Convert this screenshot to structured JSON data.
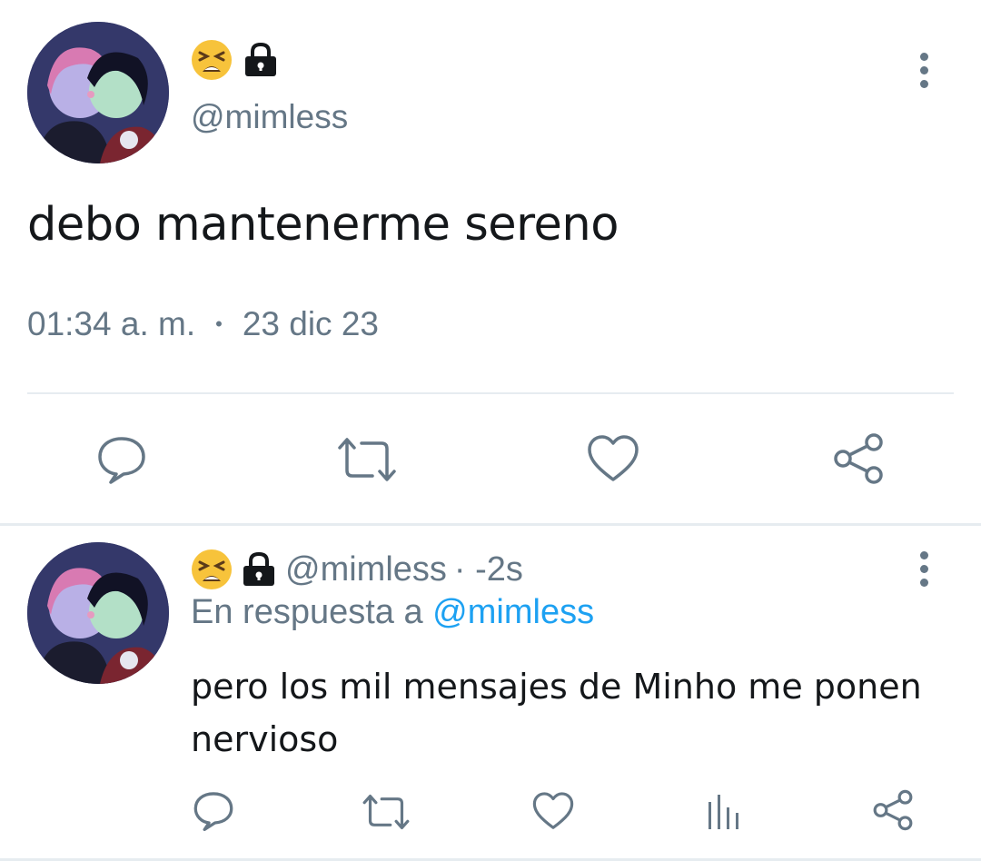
{
  "main_tweet": {
    "emoji_icon": "tired-face-emoji",
    "lock_icon": "lock-icon",
    "handle": "@mimless",
    "text": "debo mantenerme sereno",
    "time": "01:34 a. m.",
    "separator": "•",
    "date": "23 dic 23"
  },
  "reply_tweet": {
    "emoji_icon": "tired-face-emoji",
    "lock_icon": "lock-icon",
    "handle": "@mimless",
    "age": "· -2s",
    "in_reply_prefix": "En respuesta a",
    "in_reply_mention": "@mimless",
    "text": "pero los mil mensajes de Minho me ponen nervioso"
  },
  "icons": [
    "reply-icon",
    "retweet-icon",
    "like-icon",
    "share-icon",
    "analytics-icon",
    "more-icon"
  ],
  "colors": {
    "muted": "#657786",
    "text": "#14171a",
    "link": "#1da1f2",
    "divider": "#e6ecf0"
  }
}
